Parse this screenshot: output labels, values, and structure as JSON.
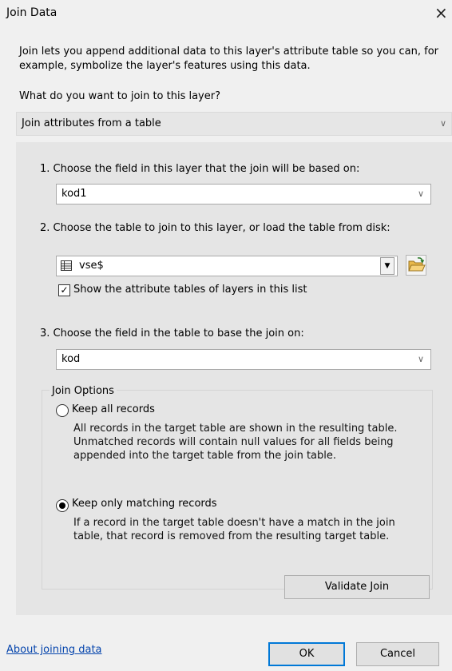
{
  "window": {
    "title": "Join Data",
    "close_glyph": "×"
  },
  "intro_text": "Join lets you append additional data to this layer's attribute table so you can, for example, symbolize the layer's features using this data.",
  "question": "What do you want to join to this layer?",
  "join_type": {
    "selected": "Join attributes from a table"
  },
  "step1": {
    "label": "1.  Choose the field in this layer that the join will be based on:",
    "value": "kod1"
  },
  "step2": {
    "label": "2.  Choose the table to join to this layer, or load the table from disk:",
    "value": "vse$",
    "table_icon": "table-icon",
    "folder_icon": "open-folder-icon",
    "show_tables_label": "Show the attribute tables of layers in this list",
    "show_tables_checked": true
  },
  "step3": {
    "label": "3.  Choose the field in the table to base the join on:",
    "value": "kod"
  },
  "join_options": {
    "title": "Join Options",
    "keep_all": {
      "label": "Keep all records",
      "selected": false,
      "description": "All records in the target table are shown in the resulting table. Unmatched records will contain null values for all fields being appended into the target table from the join table."
    },
    "keep_matching": {
      "label": "Keep only matching records",
      "selected": true,
      "description": "If a record in the target table doesn't have a match in the join table, that record is removed from the resulting target table."
    },
    "validate_label": "Validate Join"
  },
  "footer": {
    "help_link": "About joining data",
    "ok_label": "OK",
    "cancel_label": "Cancel"
  },
  "colors": {
    "link": "#0645ad",
    "default_button_border": "#0078d7"
  }
}
